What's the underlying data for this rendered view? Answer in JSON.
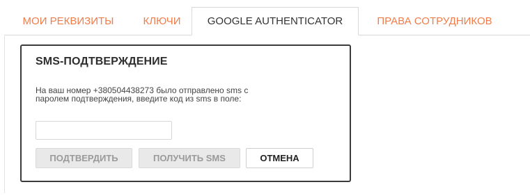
{
  "tabs": [
    {
      "label": "МОИ РЕКВИЗИТЫ",
      "active": false
    },
    {
      "label": "КЛЮЧИ",
      "active": false
    },
    {
      "label": "GOOGLE AUTHENTICATOR",
      "active": true
    },
    {
      "label": "ПРАВА СОТРУДНИКОВ",
      "active": false
    }
  ],
  "dialog": {
    "title": "SMS-ПОДТВЕРЖДЕНИЕ",
    "message_line1": "На ваш номер +380504438273 было отправлено sms с",
    "message_line2": "паролем подтверждения, введите код из sms в поле:",
    "code_value": "",
    "code_placeholder": "",
    "buttons": {
      "confirm": "ПОДТВЕРДИТЬ",
      "get_sms": "ПОЛУЧИТЬ SMS",
      "cancel": "ОТМЕНА"
    }
  },
  "colors": {
    "tab_text": "#f07c4a",
    "active_tab_text": "#333333",
    "dialog_border": "#3b3b3b",
    "disabled_button": "#e9e9e9"
  }
}
